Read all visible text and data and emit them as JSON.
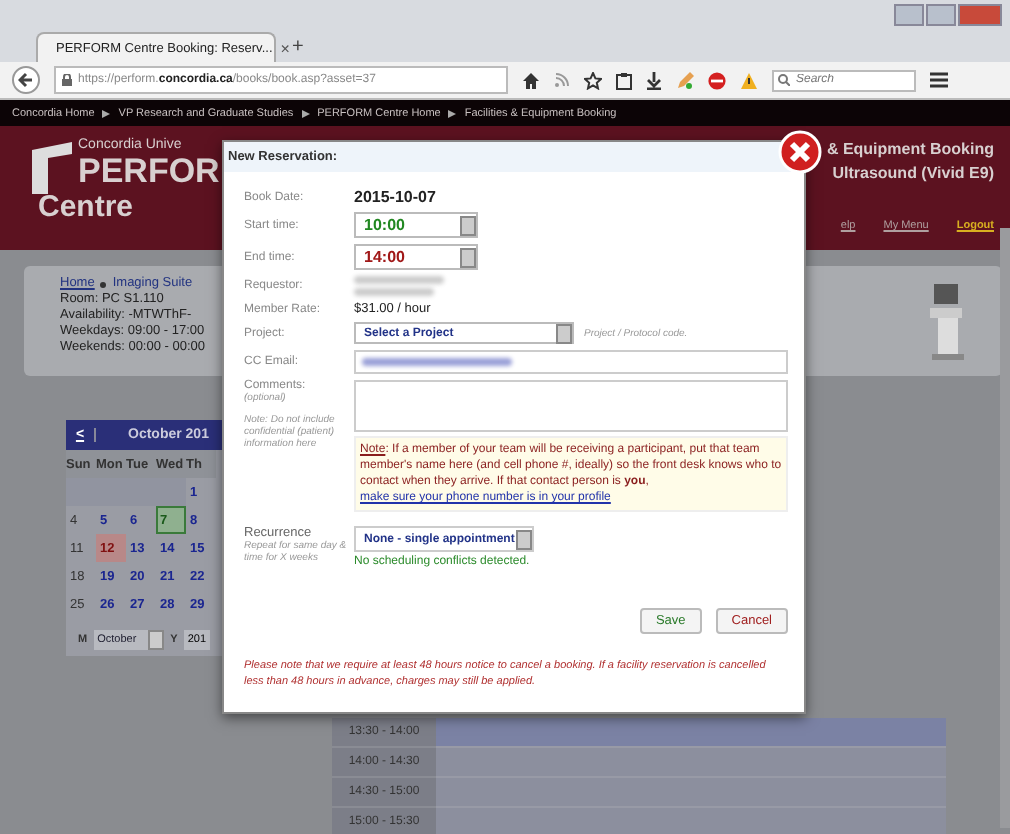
{
  "browser": {
    "tab_title": "PERFORM Centre Booking: Reserv...",
    "tab_close": "×",
    "new_tab": "+",
    "url_prefix": "https://perform.",
    "url_domain": "concordia.ca",
    "url_path": "/books/book.asp?asset=37",
    "search_placeholder": "Search"
  },
  "breadcrumb": [
    "Concordia Home",
    "VP Research and Graduate Studies",
    "PERFORM Centre Home",
    "Facilities & Equipment Booking"
  ],
  "header": {
    "university": "Concordia Unive",
    "logo_word": "PERFOR",
    "logo_sub": "Centre",
    "title": "& Equipment Booking",
    "subtitle": "Ultrasound (Vivid E9)",
    "nav": [
      {
        "label": "elp",
        "highlighted": false
      },
      {
        "label": "My Menu",
        "highlighted": false
      },
      {
        "label": "Logout",
        "highlighted": true
      }
    ]
  },
  "asset_info": {
    "home_link": "Home",
    "location": "Imaging Suite",
    "room": "Room: PC S1.110",
    "availability": "Availability: -MTWThF-",
    "weekdays": "Weekdays: 09:00 - 17:00",
    "weekends": "Weekends: 00:00 - 00:00"
  },
  "calendar": {
    "prev": "<",
    "month_title": "October 201",
    "weekdays": [
      "Sun",
      "Mon",
      "Tue",
      "Wed",
      "Th"
    ],
    "weeks": [
      [
        {
          "kind": "blank"
        },
        {
          "kind": "blank"
        },
        {
          "kind": "blank"
        },
        {
          "kind": "blank"
        },
        {
          "kind": "day",
          "day": "1",
          "selected": false,
          "today": false
        }
      ],
      [
        {
          "kind": "day",
          "day": "4",
          "selected": false,
          "today": false
        },
        {
          "kind": "day",
          "day": "5",
          "selected": false,
          "today": false
        },
        {
          "kind": "day",
          "day": "6",
          "selected": false,
          "today": false
        },
        {
          "kind": "day",
          "day": "7",
          "selected": true,
          "today": false
        },
        {
          "kind": "day",
          "day": "8",
          "selected": false,
          "today": false
        }
      ],
      [
        {
          "kind": "day",
          "day": "11",
          "selected": false,
          "today": false
        },
        {
          "kind": "day",
          "day": "12",
          "selected": false,
          "today": true
        },
        {
          "kind": "day",
          "day": "13",
          "selected": false,
          "today": false
        },
        {
          "kind": "day",
          "day": "14",
          "selected": false,
          "today": false
        },
        {
          "kind": "day",
          "day": "15",
          "selected": false,
          "today": false
        }
      ],
      [
        {
          "kind": "day",
          "day": "18",
          "selected": false,
          "today": false
        },
        {
          "kind": "day",
          "day": "19",
          "selected": false,
          "today": false
        },
        {
          "kind": "day",
          "day": "20",
          "selected": false,
          "today": false
        },
        {
          "kind": "day",
          "day": "21",
          "selected": false,
          "today": false
        },
        {
          "kind": "day",
          "day": "22",
          "selected": false,
          "today": false
        }
      ],
      [
        {
          "kind": "day",
          "day": "25",
          "selected": false,
          "today": false
        },
        {
          "kind": "day",
          "day": "26",
          "selected": false,
          "today": false
        },
        {
          "kind": "day",
          "day": "27",
          "selected": false,
          "today": false
        },
        {
          "kind": "day",
          "day": "28",
          "selected": false,
          "today": false
        },
        {
          "kind": "day",
          "day": "29",
          "selected": false,
          "today": false
        }
      ]
    ],
    "month_label": "M",
    "month_value": "October",
    "year_label": "Y",
    "year_value": "201"
  },
  "time_slots": [
    "13:30 - 14:00",
    "14:00 - 14:30",
    "14:30 - 15:00",
    "15:00 - 15:30"
  ],
  "modal": {
    "title": "New Reservation:",
    "book_date_label": "Book Date:",
    "book_date": "2015-10-07",
    "start_label": "Start time:",
    "start_time": "10:00",
    "end_label": "End time:",
    "end_time": "14:00",
    "requestor_label": "Requestor:",
    "rate_label": "Member Rate:",
    "rate": "$31.00 / hour",
    "project_label": "Project:",
    "project_value": "Select a Project",
    "project_hint": "Project / Protocol code.",
    "cc_label": "CC Email:",
    "comments_label": "Comments:",
    "comments_sub": "(optional)",
    "comments_note": "Note: Do not include confidential (patient) information here",
    "note_lead": "Note",
    "note_text": ": If a member of your team will be receiving a participant, put that team member's name here (and cell phone #, ideally) so the front desk knows who to contact when they arrive. If that contact person is **you**,",
    "note_link": "make sure your phone number is in your profile",
    "recurrence_label": "Recurrence",
    "recurrence_sub": "Repeat for same day & time for X weeks",
    "recurrence_value": "None - single appointment",
    "conflict_status": "No scheduling conflicts detected.",
    "buttons": [
      "Save",
      "Cancel"
    ],
    "footer": "Please note that we require at least 48 hours notice to cancel a booking. If a facility reservation is cancelled less than 48 hours in advance, charges may still be applied."
  }
}
